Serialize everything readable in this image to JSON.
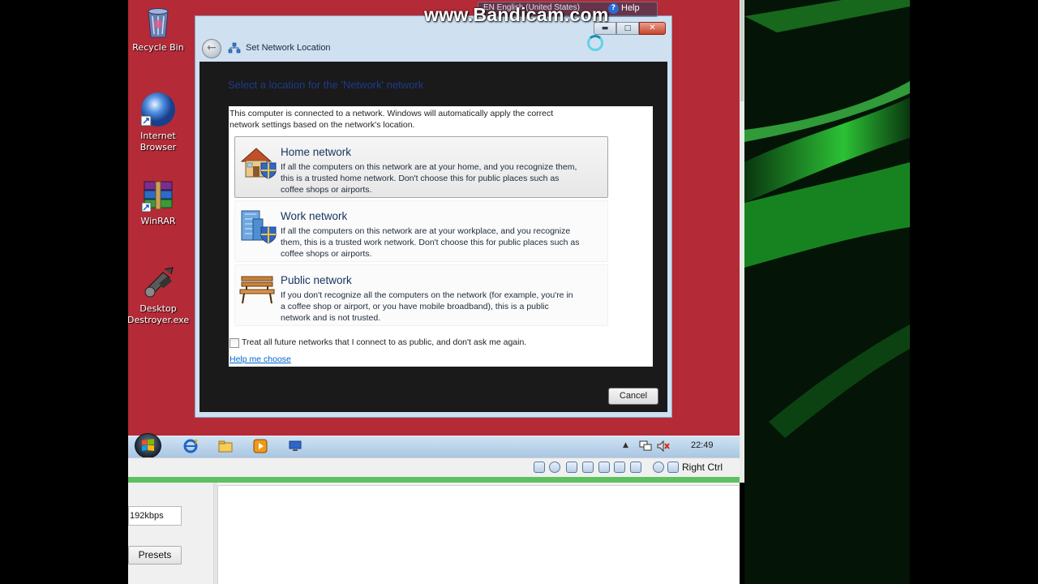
{
  "watermark": "www.Bandicam.com",
  "language_bar": {
    "text": "EN English (United States)",
    "help_label": "Help",
    "help_icon": "?"
  },
  "desktop": {
    "icons": [
      {
        "label_line1": "Recycle Bin",
        "label_line2": "",
        "icon": "recycle-bin-icon"
      },
      {
        "label_line1": "Internet",
        "label_line2": "Browser",
        "icon": "internet-browser-icon"
      },
      {
        "label_line1": "WinRAR",
        "label_line2": "",
        "icon": "winrar-icon"
      },
      {
        "label_line1": "Desktop",
        "label_line2": "Destroyer.exe",
        "icon": "desktop-destroyer-icon"
      }
    ]
  },
  "dialog": {
    "title": "Set Network Location",
    "heading": "Select a location for the 'Network' network",
    "intro_line1": "This computer is connected to a network. Windows will automatically apply the correct",
    "intro_line2": "network settings based on the network's location.",
    "options": [
      {
        "title": "Home network",
        "desc_line1": "If all the computers on this network are at your home, and you recognize them,",
        "desc_line2": "this is a trusted home network.  Don't choose this for public places such as",
        "desc_line3": "coffee shops or airports."
      },
      {
        "title": "Work network",
        "desc_line1": "If all the computers on this network are at your workplace, and you recognize",
        "desc_line2": "them, this is a trusted work network.  Don't choose this for public places such as",
        "desc_line3": "coffee shops or airports."
      },
      {
        "title": "Public network",
        "desc_line1": "If you don't recognize all the computers on the network (for example, you're in",
        "desc_line2": "a coffee shop or airport, or you have mobile broadband), this is a public",
        "desc_line3": "network and is not trusted."
      }
    ],
    "checkbox_label": "Treat all future networks that I connect to as public, and don't ask me again.",
    "checkbox_checked": false,
    "help_link": "Help me choose",
    "cancel_label": "Cancel",
    "close_glyph": "✕"
  },
  "taskbar": {
    "clock": "22:49"
  },
  "vm_status": {
    "host_key": "Right Ctrl"
  },
  "lower_app": {
    "bitrate": "192kbps",
    "presets_label": "Presets"
  },
  "colors": {
    "guest_desktop": "#b42a36",
    "dialog_heading": "#1f3a8a",
    "option_title": "#15345e",
    "link": "#0066cc"
  }
}
